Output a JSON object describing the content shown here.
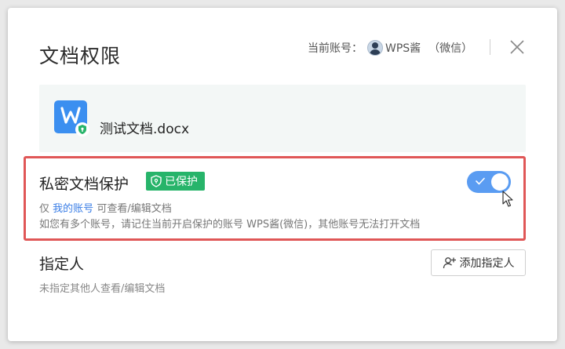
{
  "dialog": {
    "title": "文档权限",
    "account_prefix": "当前账号：",
    "account_name": "WPS酱",
    "account_source": "（微信）"
  },
  "file": {
    "name": "测试文档.docx",
    "icon": "wps-writer-file-icon",
    "icon_color": "#3b8ff0"
  },
  "private_protection": {
    "title": "私密文档保护",
    "badge": "已保护",
    "badge_color": "#27b46a",
    "toggle_on": true,
    "toggle_color": "#5a9cf2",
    "desc_prefix": "仅",
    "desc_link": "我的账号",
    "desc_suffix": "可查看/编辑文档",
    "note": "如您有多个账号，请记住当前开启保护的账号 WPS酱(微信)，其他账号无法打开文档",
    "highlight_color": "#e05757"
  },
  "assignee": {
    "title": "指定人",
    "desc": "未指定其他人查看/编辑文档",
    "add_button": "添加指定人"
  }
}
